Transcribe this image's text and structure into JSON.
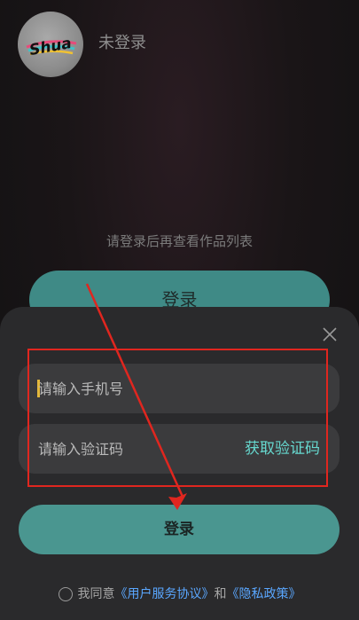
{
  "profile": {
    "avatar_logo_text": "Shua",
    "username": "未登录",
    "empty_hint": "请登录后再查看作品列表",
    "login_label": "登录"
  },
  "sheet": {
    "phone_placeholder": "请输入手机号",
    "code_placeholder": "请输入验证码",
    "get_code_label": "获取验证码",
    "submit_label": "登录",
    "agreement": {
      "prefix": "我同意",
      "user_agreement": "《用户服务协议》",
      "conjunction": "和",
      "privacy_policy": "《隐私政策》"
    }
  },
  "colors": {
    "accent": "#4a9690",
    "link": "#5aa7ff",
    "get_code": "#66d8cf",
    "annotation": "#e0261f"
  },
  "icons": [
    "close-icon",
    "radio-unchecked-icon",
    "shua-logo"
  ]
}
